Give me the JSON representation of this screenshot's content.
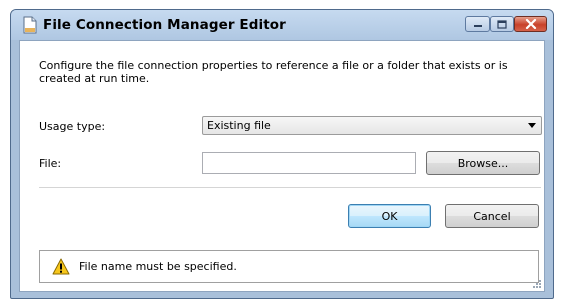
{
  "window": {
    "title": "File Connection Manager Editor"
  },
  "description": "Configure the file connection properties to reference a file or a folder that exists or is created at run time.",
  "usage_type": {
    "label": "Usage type:",
    "selected": "Existing file"
  },
  "file": {
    "label": "File:",
    "value": "",
    "browse_label": "Browse..."
  },
  "buttons": {
    "ok": "OK",
    "cancel": "Cancel"
  },
  "message": {
    "text": "File name must be specified."
  },
  "colors": {
    "titlebar": "#b5cbe6",
    "close_button": "#c8412a",
    "warning": "#f7c71c"
  }
}
